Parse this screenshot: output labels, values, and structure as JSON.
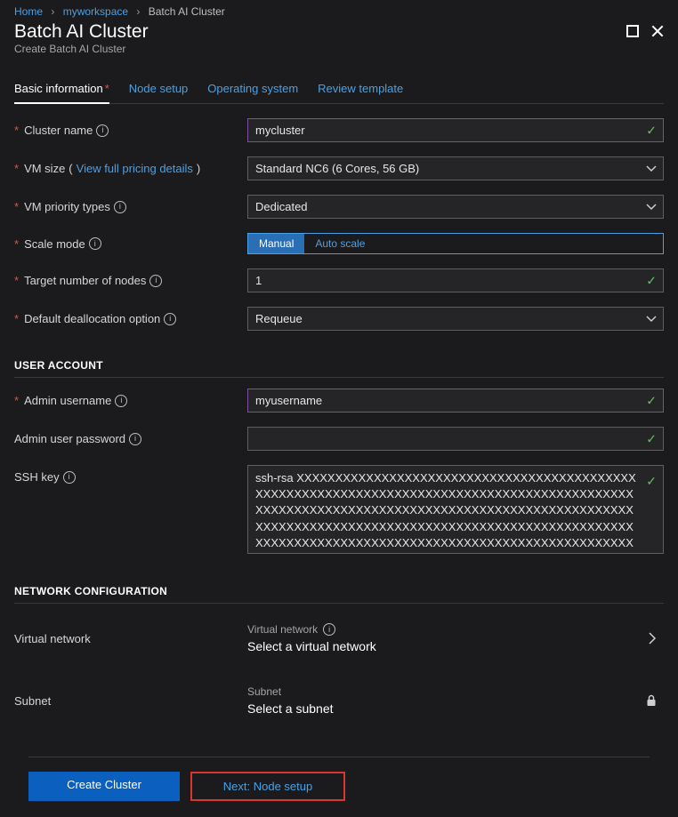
{
  "breadcrumbs": {
    "home": "Home",
    "workspace": "myworkspace",
    "current": "Batch AI Cluster"
  },
  "header": {
    "title": "Batch AI Cluster",
    "subtitle": "Create Batch AI Cluster"
  },
  "tabs": {
    "basic": "Basic information",
    "node": "Node setup",
    "os": "Operating system",
    "review": "Review template"
  },
  "labels": {
    "cluster_name": "Cluster name",
    "vm_size": "VM size",
    "vm_size_link": "View full pricing details",
    "vm_priority": "VM priority types",
    "scale_mode": "Scale mode",
    "target_nodes": "Target number of nodes",
    "dealloc": "Default deallocation option",
    "admin_user": "Admin username",
    "admin_pass": "Admin user password",
    "ssh_key": "SSH key",
    "vnet_row": "Virtual network",
    "subnet_row": "Subnet"
  },
  "sections": {
    "user": "USER ACCOUNT",
    "net": "NETWORK CONFIGURATION"
  },
  "values": {
    "cluster_name": "mycluster",
    "vm_size": "Standard NC6 (6 Cores, 56 GB)",
    "vm_priority": "Dedicated",
    "scale_manual": "Manual",
    "scale_auto": "Auto scale",
    "target_nodes": "1",
    "dealloc": "Requeue",
    "admin_user": "myusername",
    "admin_pass": "",
    "ssh_key": "ssh-rsa XXXXXXXXXXXXXXXXXXXXXXXXXXXXXXXXXXXXXXXXXXXXXXXXXXXXXXXXXXXXXXXXXXXXXXXXXXXXXXXXXXXXXXXXXXXXXXXXXXXXXXXXXXXXXXXXXXXXXXXXXXXXXXXXXXXXXXXXXXXXXXXXXXXXXXXXXXXXXXXXXXXXXXXXXXXXXXXXXXXXXXXXXXXXXXXXXXXXXXXXXXXXXXXXXXXXXXXXXXXXXXXXXXXXXXXXXXXXXXXXXXXXXXXXXXXXXXXXXXXXXXXXXXXXXXXXXXXXXXXXXXXXXXXXXXXXXXXXXXXXXXXXXXXXXXXXXXXXXXXXXXXXXXXXXXXXXXXXXXXXXXXXXXXXXXXXXXXXXXXXXXXXXXXXXXXX"
  },
  "pickers": {
    "vnet_label": "Virtual network",
    "vnet_value": "Select a virtual network",
    "subnet_label": "Subnet",
    "subnet_value": "Select a subnet"
  },
  "footer": {
    "create": "Create Cluster",
    "next": "Next: Node setup"
  },
  "colors": {
    "accent": "#4aa0e4",
    "danger": "#d9362f",
    "primary": "#0a5fbf"
  }
}
